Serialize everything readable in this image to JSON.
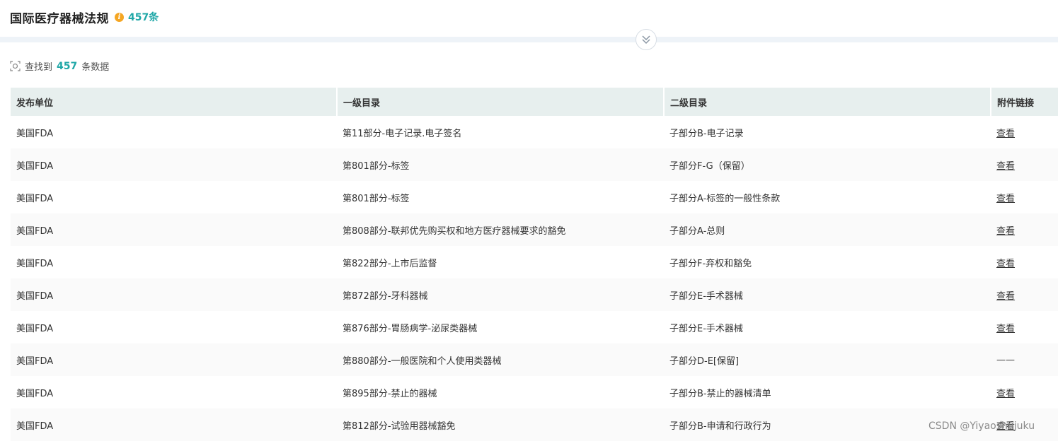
{
  "header": {
    "title": "国际医疗器械法规",
    "count_label": "457条"
  },
  "search_result": {
    "prefix": "查找到",
    "count": "457",
    "suffix": "条数据"
  },
  "table": {
    "columns": [
      "发布单位",
      "一级目录",
      "二级目录",
      "附件链接"
    ],
    "rows": [
      {
        "unit": "美国FDA",
        "level1": "第11部分-电子记录.电子签名",
        "level2": "子部分B-电子记录",
        "link": "查看"
      },
      {
        "unit": "美国FDA",
        "level1": "第801部分-标签",
        "level2": "子部分F-G（保留）",
        "link": "查看"
      },
      {
        "unit": "美国FDA",
        "level1": "第801部分-标签",
        "level2": "子部分A-标签的一般性条款",
        "link": "查看"
      },
      {
        "unit": "美国FDA",
        "level1": "第808部分-联邦优先购买权和地方医疗器械要求的豁免",
        "level2": "子部分A-总则",
        "link": "查看"
      },
      {
        "unit": "美国FDA",
        "level1": "第822部分-上市后监督",
        "level2": "子部分F-弃权和豁免",
        "link": "查看"
      },
      {
        "unit": "美国FDA",
        "level1": "第872部分-牙科器械",
        "level2": "子部分E-手术器械",
        "link": "查看"
      },
      {
        "unit": "美国FDA",
        "level1": "第876部分-胃肠病学-泌尿类器械",
        "level2": "子部分E-手术器械",
        "link": "查看"
      },
      {
        "unit": "美国FDA",
        "level1": "第880部分-一般医院和个人使用类器械",
        "level2": "子部分D-E[保留]",
        "link": "——"
      },
      {
        "unit": "美国FDA",
        "level1": "第895部分-禁止的器械",
        "level2": "子部分B-禁止的器械清单",
        "link": "查看"
      },
      {
        "unit": "美国FDA",
        "level1": "第812部分-试验用器械豁免",
        "level2": "子部分B-申请和行政行为",
        "link": "查看"
      }
    ]
  },
  "watermark": "CSDN @Yiyaoshujuku",
  "colors": {
    "accent": "#1fa7a7",
    "info_icon": "#f5a623",
    "header_row": "#e7efee",
    "band": "#eef3f8"
  }
}
